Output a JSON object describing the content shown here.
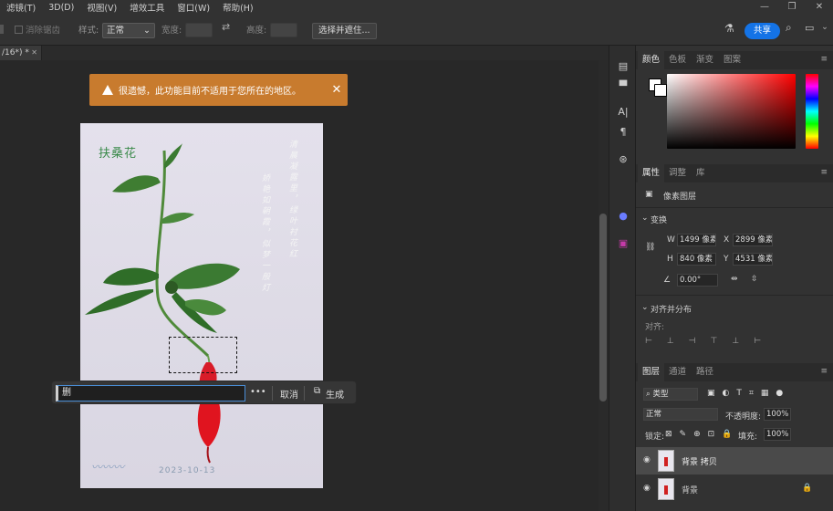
{
  "menubar": {
    "items": [
      "滤镜(T)",
      "3D(D)",
      "视图(V)",
      "增效工具",
      "窗口(W)",
      "帮助(H)"
    ],
    "window_controls": [
      "—",
      "❐",
      "✕"
    ]
  },
  "options_bar": {
    "anti_alias_label": "消除锯齿",
    "style_label": "样式:",
    "style_value": "正常",
    "width_label": "宽度:",
    "height_label": "高度:",
    "select_subject_button": "选择并遮住...",
    "share_button": "共享"
  },
  "doc_tab": {
    "title": "/16*) *",
    "close": "✕"
  },
  "toast": {
    "message": "很遗憾，此功能目前不适用于您所在的地区。",
    "close": "✕"
  },
  "photo": {
    "title": "扶桑花",
    "poem_col1": "清晨凝露里，绿叶衬花红",
    "poem_col2": "娇艳如朝霞，似梦一般灯",
    "date": "2023-10-13"
  },
  "generative_fill": {
    "input_value": "删",
    "more": "•••",
    "cancel": "取消",
    "generate": "生成"
  },
  "panels": {
    "color_tabs": [
      "颜色",
      "色板",
      "渐变",
      "图案"
    ],
    "properties_tabs": [
      "属性",
      "调整",
      "库"
    ],
    "pixel_layer_label": "像素图层",
    "transform_section": "变换",
    "w_label": "W",
    "w_value": "1499 像素",
    "x_label": "X",
    "x_value": "2899 像素",
    "h_label": "H",
    "h_value": "840 像素",
    "y_label": "Y",
    "y_value": "4531 像素",
    "angle_value": "0.00°",
    "align_section": "对齐并分布",
    "align_label": "对齐:",
    "layers_tabs": [
      "图层",
      "通道",
      "路径"
    ],
    "kind_filter": "类型",
    "blend_mode": "正常",
    "opacity_label": "不透明度:",
    "opacity_value": "100%",
    "lock_label": "锁定:",
    "fill_label": "填充:",
    "fill_value": "100%",
    "layers": [
      {
        "name": "背景 拷贝",
        "selected": true
      },
      {
        "name": "背景",
        "selected": false
      }
    ]
  },
  "colors": {
    "toast_bg": "#c87b2e",
    "accent": "#1473e6",
    "panel_bg": "#323232",
    "foreground": "#ffffff",
    "background": "#ffffff"
  }
}
